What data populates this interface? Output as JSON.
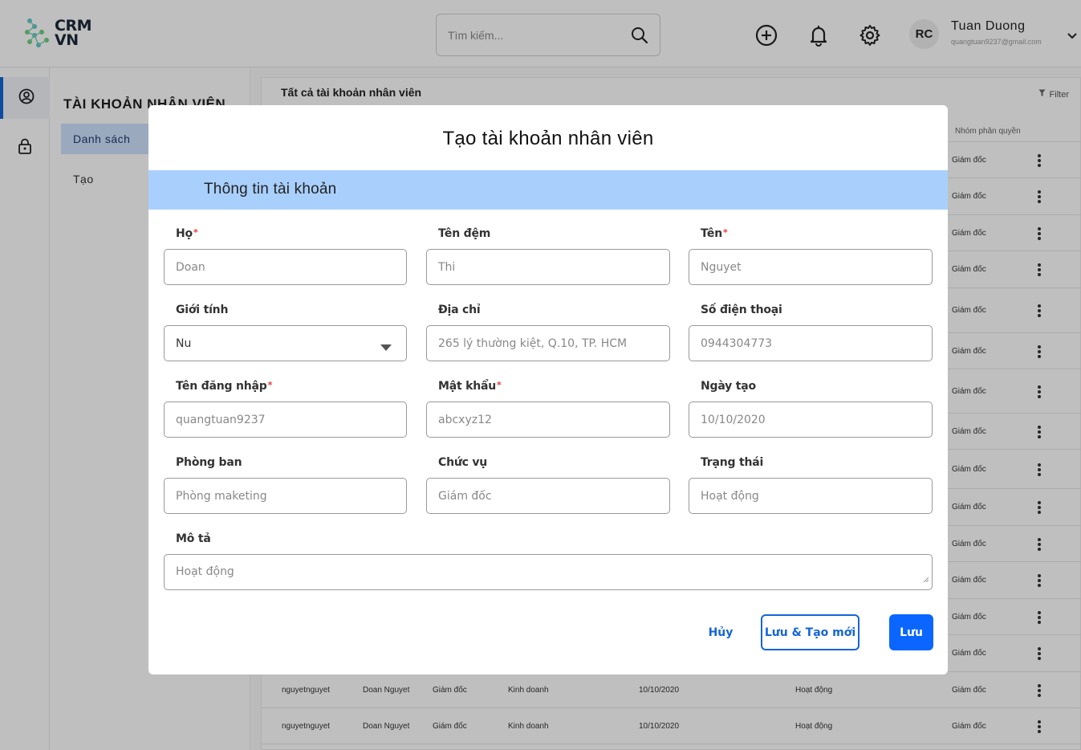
{
  "app": {
    "logo_line1": "CRM",
    "logo_line2": "VN"
  },
  "header": {
    "search_placeholder": "Tìm kiếm...",
    "icons": [
      "search-icon",
      "add-circle-icon",
      "bell-icon",
      "gear-icon",
      "chevron-down-icon"
    ],
    "avatar_initials": "RC",
    "user_name": "Tuan Duong",
    "user_email": "quangtuan9237@gmail.com"
  },
  "rail": {
    "icons": [
      "user-circle-icon",
      "lock-icon"
    ]
  },
  "subnav": {
    "title": "TÀI KHOẢN NHÂN VIÊN",
    "items": [
      {
        "label": "Danh sách",
        "active": true
      },
      {
        "label": "Tạo",
        "active": false
      }
    ]
  },
  "list": {
    "title": "Tất cả tài khoản nhân viên",
    "filter_label": "Filter",
    "visible_header": "Nhóm phân quyền",
    "role_column": [
      "Giám đốc",
      "Giám đốc",
      "Giám đốc",
      "Giám đốc",
      "Giám đốc",
      "Giám đốc",
      "Giám đốc",
      "Giám đốc",
      "Giám đốc",
      "Giám đốc",
      "Giám đốc",
      "Giám đốc",
      "Giám đốc",
      "Giám đốc",
      "Giám đốc",
      "Giám đốc"
    ],
    "full_rows": [
      {
        "username": "nguyetnguyet",
        "name": "Doan Nguyet",
        "position": "Giám đốc",
        "department": "Kinh doanh",
        "created": "10/10/2020",
        "status": "Hoạt động",
        "role": "Giám đốc"
      },
      {
        "username": "nguyetnguyet",
        "name": "Doan Nguyet",
        "position": "Giám đốc",
        "department": "Kinh doanh",
        "created": "10/10/2020",
        "status": "Hoạt động",
        "role": "Giám đốc"
      }
    ]
  },
  "modal": {
    "title": "Tạo tài khoản nhân viên",
    "section": "Thông tin tài khoản",
    "fields": {
      "last_name": {
        "label": "Họ",
        "required": true,
        "placeholder": "Doan"
      },
      "middle_name": {
        "label": "Tên đệm",
        "required": false,
        "placeholder": "Thi"
      },
      "first_name": {
        "label": "Tên",
        "required": true,
        "placeholder": "Nguyet"
      },
      "gender": {
        "label": "Giới tính",
        "required": false,
        "value": "Nu"
      },
      "address": {
        "label": "Địa chỉ",
        "required": false,
        "placeholder": "265 lý thường kiệt, Q.10, TP. HCM"
      },
      "phone": {
        "label": "Số điện thoại",
        "required": false,
        "placeholder": "0944304773"
      },
      "username": {
        "label": "Tên đăng nhập",
        "required": true,
        "placeholder": "quangtuan9237"
      },
      "password": {
        "label": "Mật khẩu",
        "required": true,
        "placeholder": "abcxyz12"
      },
      "created": {
        "label": "Ngày tạo",
        "required": false,
        "placeholder": "10/10/2020"
      },
      "department": {
        "label": "Phòng ban",
        "required": false,
        "placeholder": "Phòng maketing"
      },
      "position": {
        "label": "Chức vụ",
        "required": false,
        "placeholder": "Giám đốc"
      },
      "status": {
        "label": "Trạng thái",
        "required": false,
        "placeholder": "Hoạt động"
      },
      "description": {
        "label": "Mô tả",
        "required": false,
        "placeholder": "Hoạt động"
      }
    },
    "required_mark": "*",
    "buttons": {
      "cancel": "Hủy",
      "save_new": "Lưu & Tạo mới",
      "save": "Lưu"
    }
  },
  "colors": {
    "primary": "#0a66ff",
    "section_bg": "#a9d0fd",
    "required": "#e53935"
  }
}
